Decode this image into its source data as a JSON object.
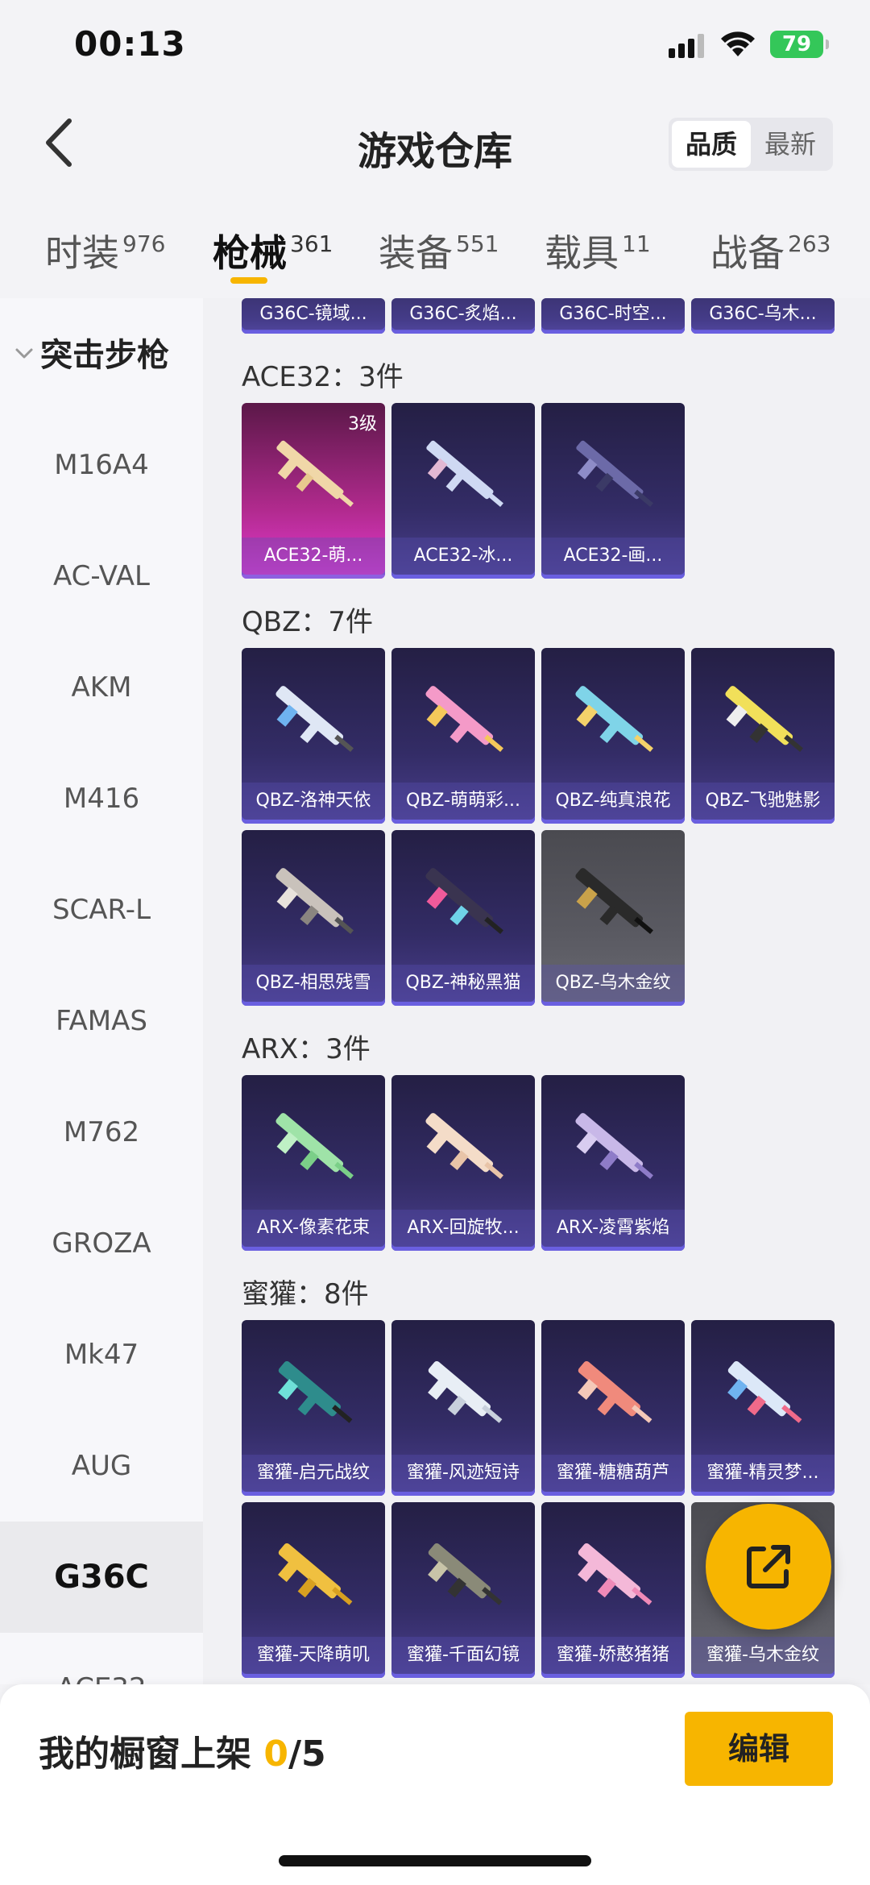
{
  "status_bar": {
    "time": "00:13",
    "battery": "79"
  },
  "header": {
    "title": "游戏仓库",
    "sort_options": [
      "品质",
      "最新"
    ],
    "sort_selected": "品质"
  },
  "tabs": [
    {
      "label": "时装",
      "count": "976"
    },
    {
      "label": "枪械",
      "count": "361",
      "active": true
    },
    {
      "label": "装备",
      "count": "551"
    },
    {
      "label": "载具",
      "count": "11"
    },
    {
      "label": "战备",
      "count": "263"
    }
  ],
  "sidebar": {
    "category": "突击步枪",
    "items": [
      "M16A4",
      "AC-VAL",
      "AKM",
      "M416",
      "SCAR-L",
      "FAMAS",
      "M762",
      "GROZA",
      "Mk47",
      "AUG",
      "G36C",
      "ACE32"
    ],
    "active": "G36C"
  },
  "top_partial_items": [
    "G36C-镜域...",
    "G36C-炙焰...",
    "G36C-时空...",
    "G36C-乌木..."
  ],
  "sections": [
    {
      "title": "ACE32：3件",
      "items": [
        {
          "label": "ACE32-萌...",
          "level": "3级",
          "style": "pink"
        },
        {
          "label": "ACE32-冰..."
        },
        {
          "label": "ACE32-画..."
        }
      ]
    },
    {
      "title": "QBZ：7件",
      "items": [
        {
          "label": "QBZ-洛神天依"
        },
        {
          "label": "QBZ-萌萌彩..."
        },
        {
          "label": "QBZ-纯真浪花"
        },
        {
          "label": "QBZ-飞驰魅影"
        },
        {
          "label": "QBZ-相思残雪"
        },
        {
          "label": "QBZ-神秘黑猫"
        },
        {
          "label": "QBZ-乌木金纹",
          "style": "grey"
        }
      ]
    },
    {
      "title": "ARX：3件",
      "items": [
        {
          "label": "ARX-像素花束"
        },
        {
          "label": "ARX-回旋牧..."
        },
        {
          "label": "ARX-凌霄紫焰"
        }
      ]
    },
    {
      "title": "蜜獾：8件",
      "items": [
        {
          "label": "蜜獾-启元战纹"
        },
        {
          "label": "蜜獾-风迹短诗"
        },
        {
          "label": "蜜獾-糖糖葫芦"
        },
        {
          "label": "蜜獾-精灵梦..."
        },
        {
          "label": "蜜獾-天降萌叽"
        },
        {
          "label": "蜜獾-千面幻镜"
        },
        {
          "label": "蜜獾-娇憨猪猪"
        },
        {
          "label": "蜜獾-乌木金纹",
          "style": "grey"
        }
      ]
    }
  ],
  "bottom_bar": {
    "shelf_label": "我的橱窗上架",
    "shelf_count": "0",
    "shelf_total": "/5",
    "edit_label": "编辑"
  },
  "colors": {
    "accent": "#f7b500",
    "card_purple": "#332c66",
    "card_pink": "#e33ad0"
  },
  "icons": {
    "back": "chevron-left-icon",
    "fab": "share-external-icon",
    "signal": "cellular-icon",
    "wifi": "wifi-icon"
  }
}
